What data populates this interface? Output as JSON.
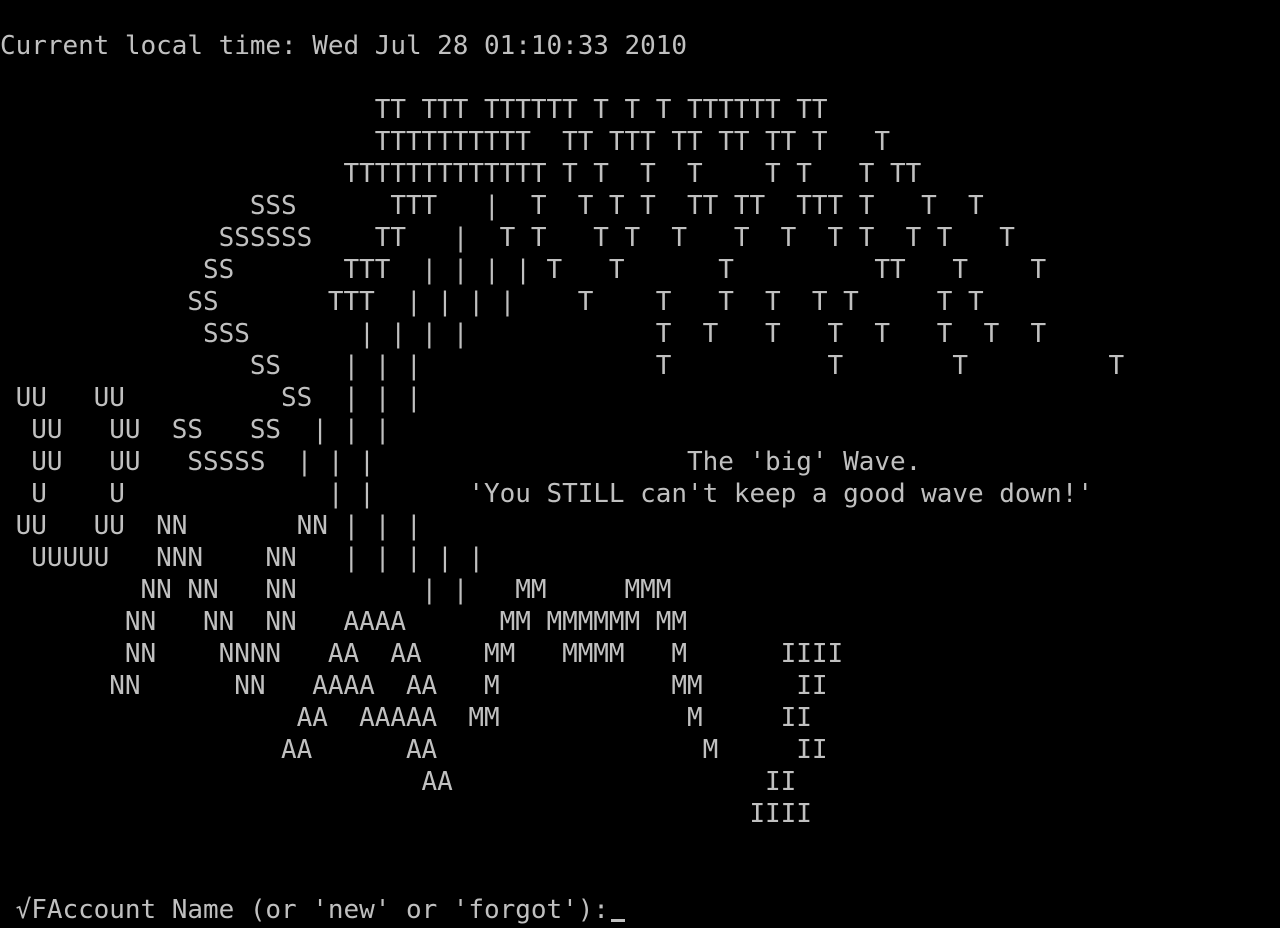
{
  "terminal": {
    "foreground": "#c0c0c0",
    "background": "#000000",
    "header_line": "Current local time: Wed Jul 28 01:10:33 2010",
    "art_lines": [
      "                        TT TTT TTTTTT T T T TTTTTT TT",
      "                        TTTTTTTTTT  TT TTT TT TT TT T   T",
      "                      TTTTTTTTTTTTT T T  T  T    T T   T TT",
      "                SSS      TTT   |  T  T T T  TT TT  TTT T   T  T",
      "              SSSSSS    TT   |  T T   T T  T   T  T  T T  T T   T",
      "             SS       TTT  | | | | T   T      T         TT   T    T",
      "            SS       TTT  | | | |    T    T   T  T  T T     T T",
      "             SSS       | | | |            T  T   T   T  T   T  T  T",
      "                SS    | | |               T          T       T         T",
      " UU   UU          SS  | | |",
      "  UU   UU  SS   SS  | | |",
      "  UU   UU   SSSSS  | | |                    The 'big' Wave.",
      "  U    U             | |      'You STILL can't keep a good wave down!'",
      " UU   UU  NN       NN | | |",
      "  UUUUU   NNN    NN   | | | | |",
      "         NN NN   NN        | |   MM     MMM",
      "        NN   NN  NN   AAAA      MM MMMMMM MM",
      "        NN    NNNN   AA  AA    MM   MMMM   M      IIII",
      "       NN      NN   AAAA  AA   M           MM      II",
      "                   AA  AAAAA  MM            M     II",
      "                  AA      AA                 M     II",
      "                           AA                    II",
      "                                                IIII"
    ],
    "prompt_prefix": " √F",
    "prompt_text": "Account Name (or 'new' or 'forgot'):"
  }
}
